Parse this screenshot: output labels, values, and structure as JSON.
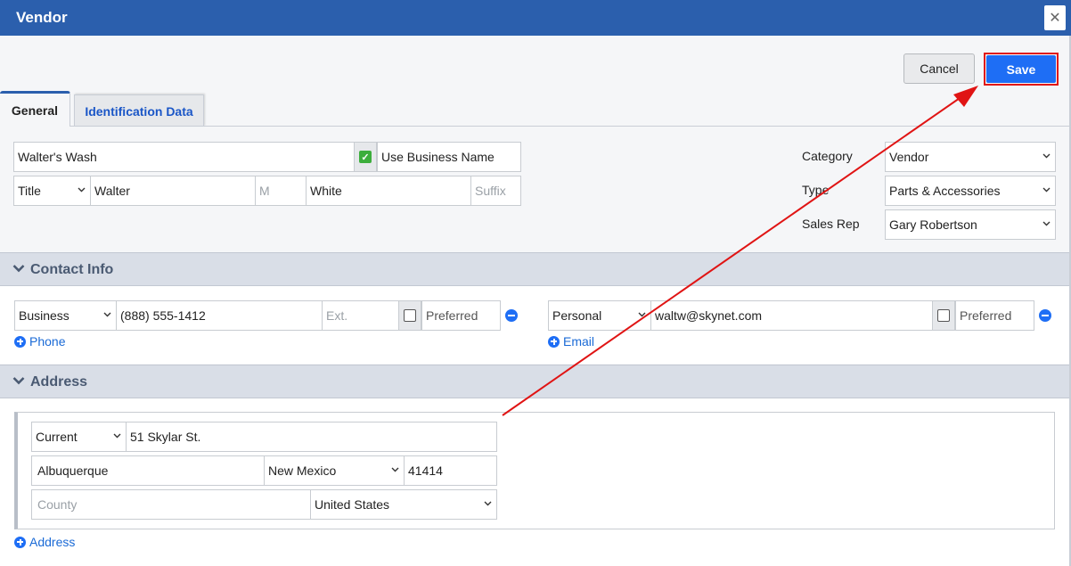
{
  "window": {
    "title": "Vendor",
    "close_label": "✕"
  },
  "actions": {
    "cancel_label": "Cancel",
    "save_label": "Save"
  },
  "tabs": [
    {
      "label": "General",
      "active": true
    },
    {
      "label": "Identification Data",
      "active": false
    }
  ],
  "general": {
    "business_name": "Walter's Wash",
    "use_business_name_label": "Use Business Name",
    "use_business_name_checked": true,
    "title_value": "Title",
    "first_name": "Walter",
    "middle_placeholder": "M",
    "last_name": "White",
    "suffix_placeholder": "Suffix",
    "category_label": "Category",
    "category_value": "Vendor",
    "type_label": "Type",
    "type_value": "Parts & Accessories",
    "sales_rep_label": "Sales Rep",
    "sales_rep_value": "Gary Robertson"
  },
  "contact": {
    "section_title": "Contact Info",
    "phone": {
      "type_value": "Business",
      "number": "(888) 555-1412",
      "ext_placeholder": "Ext.",
      "preferred_label": "Preferred",
      "add_label": "Phone"
    },
    "email": {
      "type_value": "Personal",
      "address": "waltw@skynet.com",
      "preferred_label": "Preferred",
      "add_label": "Email"
    }
  },
  "address": {
    "section_title": "Address",
    "status_value": "Current",
    "street": "51 Skylar St.",
    "city": "Albuquerque",
    "state": "New Mexico",
    "zip": "41414",
    "county_placeholder": "County",
    "country": "United States",
    "add_label": "Address"
  },
  "colors": {
    "titlebar": "#2b5fad",
    "save_button": "#1e6ef5",
    "annotation": "#e01414"
  }
}
